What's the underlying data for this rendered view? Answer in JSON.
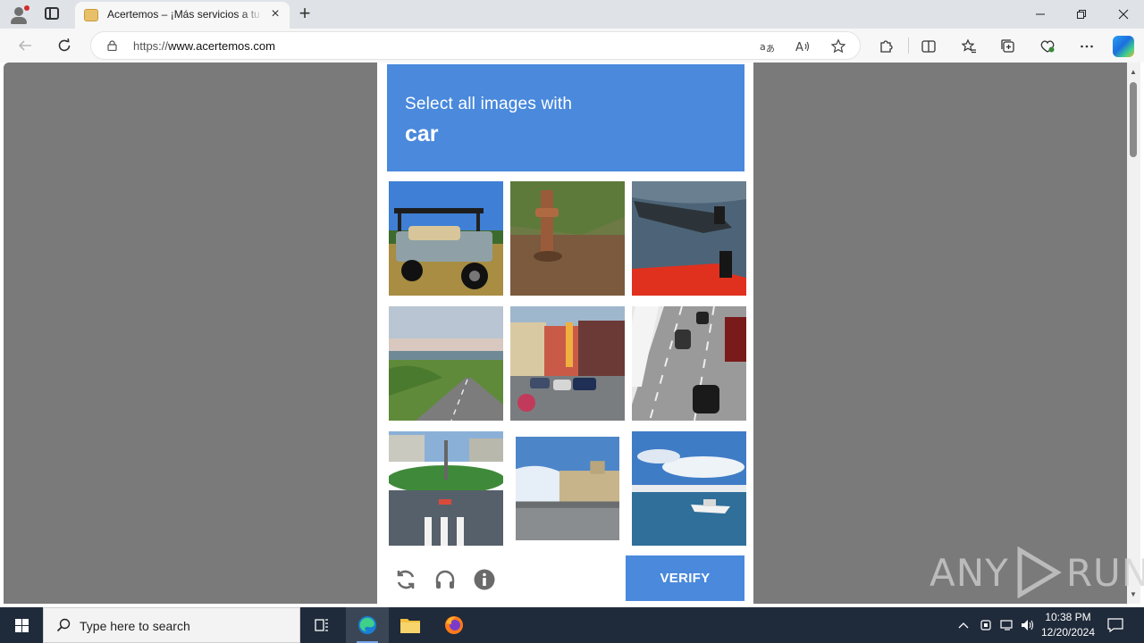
{
  "browser": {
    "tab_title": "Acertemos – ¡Más servicios a tu alcance!",
    "url_prefix": "https://",
    "url_host": "www.acertemos.com"
  },
  "captcha": {
    "instruction": "Select all images with",
    "target": "car",
    "verify_label": "VERIFY",
    "tiles": [
      {
        "subject": "golf-cart"
      },
      {
        "subject": "rusty-post"
      },
      {
        "subject": "boats"
      },
      {
        "subject": "coastal-road"
      },
      {
        "subject": "main-street-cars"
      },
      {
        "subject": "highway-traffic"
      },
      {
        "subject": "crosswalk-roundabout"
      },
      {
        "subject": "town-street"
      },
      {
        "subject": "sea-boat"
      }
    ]
  },
  "watermark": {
    "left": "ANY",
    "right": "RUN"
  },
  "taskbar": {
    "search_placeholder": "Type here to search",
    "time": "10:38 PM",
    "date": "12/20/2024"
  },
  "colors": {
    "captcha_blue": "#4a89dc",
    "page_gray": "#7a7a7a",
    "taskbar": "#1f2a3a"
  }
}
